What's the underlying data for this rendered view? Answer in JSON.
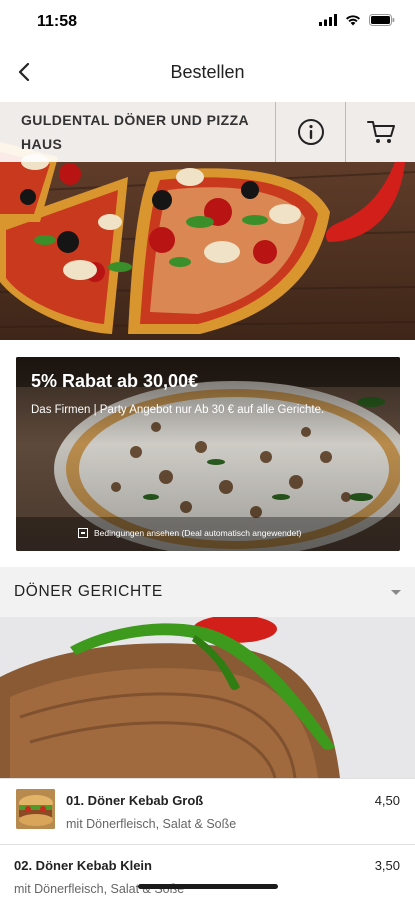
{
  "status_bar": {
    "time": "11:58",
    "icons": [
      "signal-icon",
      "wifi-icon",
      "battery-icon"
    ]
  },
  "nav": {
    "title": "Bestellen",
    "back_icon": "chevron-left-icon"
  },
  "shop": {
    "name": "GULDENTAL DÖNER UND PIZZA HAUS",
    "info_icon": "info-icon",
    "cart_icon": "cart-icon"
  },
  "deal": {
    "title": "5% Rabat ab 30,00€",
    "description": "Das Firmen | Party Angebot nur Ab 30 € auf alle Gerichte.",
    "conditions": "Bedingungen ansehen (Deal automatisch angewendet)"
  },
  "section": {
    "title": "DÖNER GERICHTE",
    "chevron_icon": "chevron-down-icon"
  },
  "items": [
    {
      "name": "01. Döner Kebab Groß",
      "description": "mit Dönerfleisch, Salat & Soße",
      "price": "4,50"
    },
    {
      "name": "02. Döner Kebab Klein",
      "description": "mit Dönerfleisch, Salat & Soße",
      "price": "3,50"
    }
  ],
  "colors": {
    "accent": "#1a1a1a",
    "section_bg": "#f2f2f2",
    "pepper_red": "#d21f1a",
    "pepper_green": "#3e9a1c"
  }
}
